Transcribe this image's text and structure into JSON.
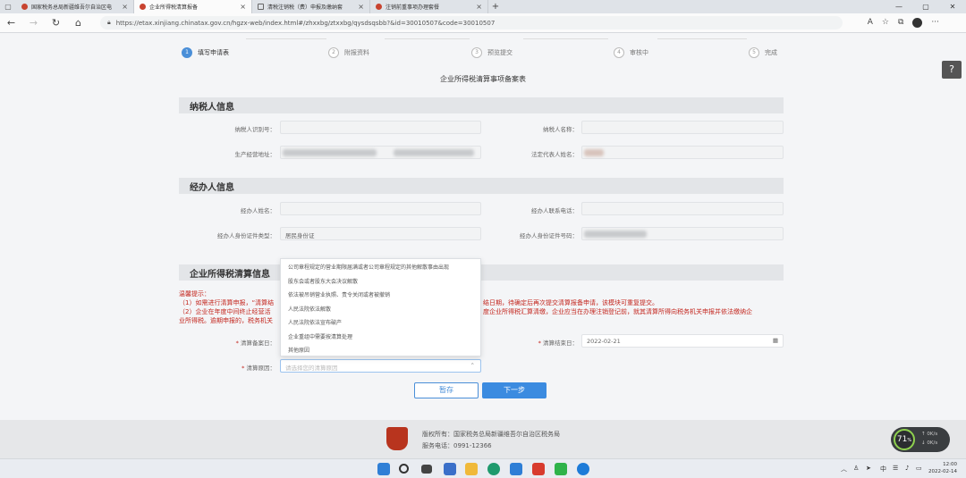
{
  "browser": {
    "tabs": [
      {
        "title": "国家税务总局新疆维吾尔自治区电"
      },
      {
        "title": "企业所得税清算报备"
      },
      {
        "title": "清税注销税（费）申报及缴纳套"
      },
      {
        "title": "注销前重事项办理套餐"
      }
    ],
    "url": "https://etax.xinjiang.chinatax.gov.cn/hgzx-web/index.html#/zhxxbg/ztxxbg/qysdsqsbb?&id=30010507&code=30010507"
  },
  "steps": [
    {
      "num": "1",
      "label": "填写申请表"
    },
    {
      "num": "2",
      "label": "附报资料"
    },
    {
      "num": "3",
      "label": "预览提交"
    },
    {
      "num": "4",
      "label": "审核中"
    },
    {
      "num": "5",
      "label": "完成"
    }
  ],
  "form_title": "企业所得税清算事项备案表",
  "sections": {
    "taxpayer": "纳税人信息",
    "agent": "经办人信息",
    "liquidation": "企业所得税清算信息"
  },
  "taxpayer": {
    "id_label": "纳税人识别号：",
    "name_label": "纳税人名称：",
    "address_label": "生产经营地址：",
    "legal_rep_label": "法定代表人姓名："
  },
  "agent": {
    "name_label": "经办人姓名：",
    "phone_label": "经办人联系电话：",
    "id_type_label": "经办人身份证件类型：",
    "id_type_value": "居民身份证",
    "id_no_label": "经办人身份证件号码："
  },
  "warning": {
    "title": "温馨提示：",
    "line1_a": "（1）如需进行清算申报，“清算结",
    "line1_b": "结日期，待确定后再次提交清算报备申请，该模块可重复提交。",
    "line2_a": "（2）企业在年度中间终止经营活",
    "line2_b": "度企业所得税汇算清缴，企业应当在办理注销登记前，就其清算所得向税务机关申报并依法缴纳企",
    "line3_a": "业所得税。逾期申报的，税务机关",
    "line3_b": ""
  },
  "liquidation": {
    "start_label": "清算备案日：",
    "end_label": "清算结束日：",
    "end_value": "2022-02-21",
    "reason_label": "清算原因：",
    "reason_placeholder": "请选择您的清算原因",
    "options": [
      "公司章程规定的营业期限届满或者公司章程规定的其他解散事由出现",
      "股东会或者股东大会决议解散",
      "依法被吊销营业执照、责令关闭或者被撤销",
      "人民法院依法解散",
      "人民法院依法宣布破产",
      "企业重组中需要按清算处理",
      "其他原因"
    ]
  },
  "buttons": {
    "save": "暂存",
    "next": "下一步"
  },
  "footer": {
    "copyright": "版权所有：国家税务总局新疆维吾尔自治区税务局",
    "phone": "服务电话：0991-12366"
  },
  "gauge": {
    "value": "71",
    "unit": "%",
    "up": "0K/s",
    "down": "0K/s"
  },
  "taskbar": {
    "time": "12:00",
    "date": "2022-02-14",
    "ime": "中"
  }
}
